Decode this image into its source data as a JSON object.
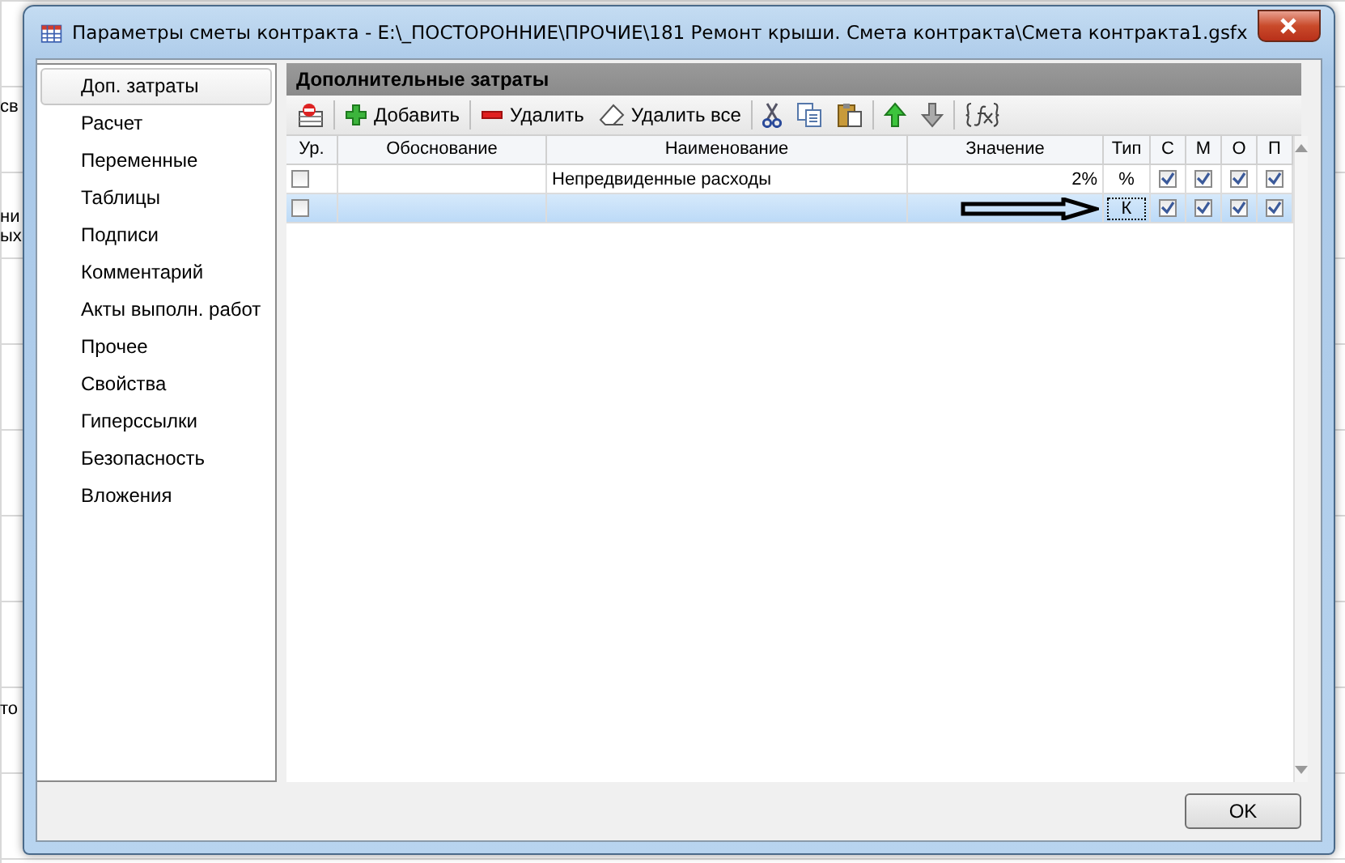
{
  "background": {
    "fragments": [
      "св",
      "ни",
      "ых",
      "то"
    ]
  },
  "window": {
    "title": "Параметры сметы контракта - E:\\_ПОСТОРОННИЕ\\ПРОЧИЕ\\181 Ремонт крыши. Смета контракта\\Смета контракта1.gsfx"
  },
  "sidebar": {
    "items": [
      {
        "label": "Доп. затраты",
        "selected": true
      },
      {
        "label": "Расчет",
        "selected": false
      },
      {
        "label": "Переменные",
        "selected": false
      },
      {
        "label": "Таблицы",
        "selected": false
      },
      {
        "label": "Подписи",
        "selected": false
      },
      {
        "label": "Комментарий",
        "selected": false
      },
      {
        "label": "Акты выполн. работ",
        "selected": false
      },
      {
        "label": "Прочее",
        "selected": false
      },
      {
        "label": "Свойства",
        "selected": false
      },
      {
        "label": "Гиперссылки",
        "selected": false
      },
      {
        "label": "Безопасность",
        "selected": false
      },
      {
        "label": "Вложения",
        "selected": false
      }
    ]
  },
  "panel": {
    "title": "Дополнительные затраты"
  },
  "toolbar": [
    {
      "kind": "icon"
    },
    {
      "kind": "separator"
    },
    {
      "kind": "labeled",
      "label": "Добавить"
    },
    {
      "kind": "separator"
    },
    {
      "kind": "labeled",
      "label": "Удалить"
    },
    {
      "kind": "labeled",
      "label": "Удалить все"
    },
    {
      "kind": "separator"
    },
    {
      "kind": "icon"
    },
    {
      "kind": "icon"
    },
    {
      "kind": "icon"
    },
    {
      "kind": "separator"
    },
    {
      "kind": "icon"
    },
    {
      "kind": "icon"
    },
    {
      "kind": "separator"
    },
    {
      "kind": "icon"
    }
  ],
  "table": {
    "columns": [
      "Ур.",
      "Обоснование",
      "Наименование",
      "Значение",
      "Тип",
      "С",
      "М",
      "О",
      "П"
    ],
    "rows": [
      {
        "level": false,
        "basis": "",
        "name": "Непредвиденные расходы",
        "value": "2%",
        "type": "%",
        "c": true,
        "m": true,
        "o": true,
        "p": true,
        "selected": false,
        "arrow": false
      },
      {
        "level": false,
        "basis": "",
        "name": "",
        "value": "",
        "type": "К",
        "c": true,
        "m": true,
        "o": true,
        "p": true,
        "selected": true,
        "arrow": true
      }
    ]
  },
  "buttons": [
    "OK"
  ]
}
